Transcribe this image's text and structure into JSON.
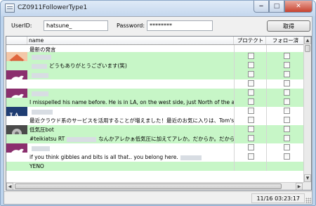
{
  "window": {
    "title": "CZ0911FollowerType1"
  },
  "form": {
    "userid_label": "UserID:",
    "userid_value": "hatsune_",
    "password_label": "Password:",
    "password_value": "********",
    "fetch_label": "取得"
  },
  "columns": {
    "name": "name",
    "protect": "プロテクト",
    "followed": "フォロー済"
  },
  "rows": [
    {
      "text": "最新の発言",
      "bg": "white",
      "protect": false,
      "followed": false
    },
    {
      "text": "",
      "bg": "green",
      "protect": false,
      "followed": false
    },
    {
      "text": "どうもありがとうございます(笑)",
      "bg": "green",
      "protect": false,
      "followed": false
    },
    {
      "text": "",
      "bg": "green",
      "protect": false,
      "followed": false
    },
    {
      "text": "",
      "bg": "white",
      "protect": false,
      "followed": false
    },
    {
      "text": "",
      "bg": "green",
      "protect": false,
      "followed": false
    },
    {
      "text": "I misspelled his name before.  He is in LA, on the west side, just North of the airport. On La Tierra.",
      "bg": "green",
      "protect": false,
      "followed": false
    },
    {
      "text": "",
      "bg": "white",
      "protect": false,
      "followed": false
    },
    {
      "text": "最近クラウド系のサービスを活用することが増えました！最近のお気に入りは、Tom's Planner オンラインでガントチャートが管理",
      "bg": "white",
      "protect": false,
      "followed": false
    },
    {
      "text": "低気圧bot",
      "bg": "green",
      "protect": false,
      "followed": false
    },
    {
      "text": "#teikiatsu RT",
      "text2": "なんかアレかぁ低気圧に加えてアレか。だからか。だからだったのか",
      "bg": "green",
      "protect": false,
      "followed": false
    },
    {
      "text": "",
      "bg": "white",
      "protect": false,
      "followed": false
    },
    {
      "text": "if you think gibbles and bits is all that.. you belong here.",
      "bg": "white",
      "protect": false,
      "followed": false
    },
    {
      "text": "YENO",
      "bg": "green",
      "protect": false,
      "followed": false
    }
  ],
  "status": {
    "time": "11/16 03:23:17"
  },
  "colors": {
    "row_green": "#c7f6c7",
    "title_bar": "#c4d7ee",
    "close_button": "#c8422f"
  },
  "icons": {
    "app": "window-icon",
    "minimize": "minimize-icon",
    "maximize": "maximize-icon",
    "close": "close-icon"
  }
}
